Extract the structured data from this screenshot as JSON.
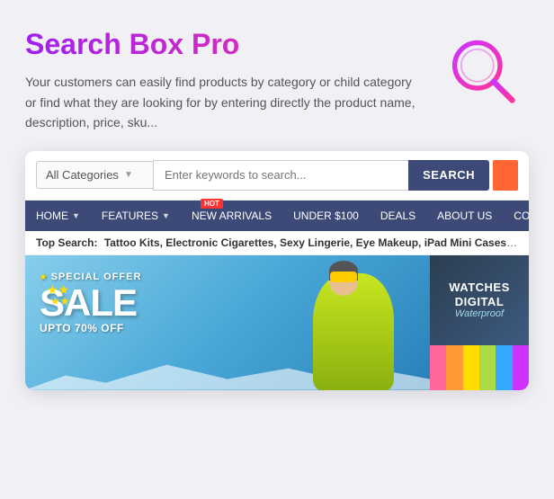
{
  "title": "Search Box Pro",
  "description": "Your customers can easily find products by category or child category or find what they are looking for by entering directly the product name, description, price, sku...",
  "search": {
    "category_placeholder": "All Categories",
    "input_placeholder": "Enter keywords to search...",
    "button_label": "SEARCH"
  },
  "nav": {
    "items": [
      {
        "label": "HOME",
        "has_arrow": true
      },
      {
        "label": "FEATURES",
        "has_arrow": true
      },
      {
        "label": "NEW ARRIVALS",
        "has_arrow": false,
        "hot_badge": true
      },
      {
        "label": "UNDER $100",
        "has_arrow": false
      },
      {
        "label": "DEALS",
        "has_arrow": false
      },
      {
        "label": "ABOUT US",
        "has_arrow": false
      },
      {
        "label": "CONTAC",
        "has_arrow": false
      }
    ],
    "hot_badge": "HOT"
  },
  "top_search": {
    "label": "Top Search:",
    "items": "Tattoo Kits,  Electronic Cigarettes,  Sexy Lingerie,  Eye Makeup,  iPad Mini Cases,  Tattoo Supplies,  RC Helico"
  },
  "hero": {
    "special_offer": "SPECIAL OFFER",
    "sale": "SALE",
    "upto": "UPTO 70% OFF"
  },
  "watches_panel": {
    "line1": "WATCHES",
    "line2": "DIGITAL",
    "line3": "Waterproof"
  },
  "hair_colors": [
    "#ff6699",
    "#ff9933",
    "#ffdd00",
    "#99dd33",
    "#33aaff",
    "#cc33ff"
  ]
}
